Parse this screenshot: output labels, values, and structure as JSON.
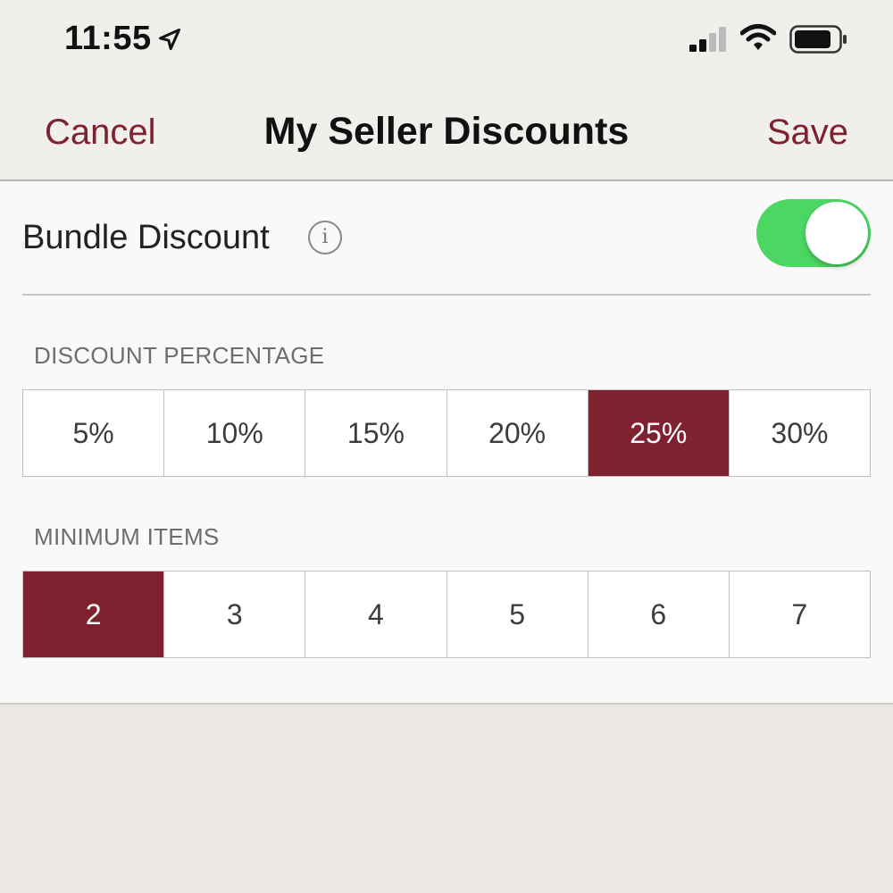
{
  "status": {
    "time": "11:55"
  },
  "nav": {
    "cancel": "Cancel",
    "title": "My Seller Discounts",
    "save": "Save"
  },
  "bundle": {
    "label": "Bundle Discount",
    "info_glyph": "i",
    "enabled": true
  },
  "discount": {
    "heading": "DISCOUNT PERCENTAGE",
    "options": [
      "5%",
      "10%",
      "15%",
      "20%",
      "25%",
      "30%"
    ],
    "selected": "25%"
  },
  "min_items": {
    "heading": "MINIMUM ITEMS",
    "options": [
      "2",
      "3",
      "4",
      "5",
      "6",
      "7"
    ],
    "selected": "2"
  },
  "colors": {
    "accent": "#7e2230",
    "toggle_on": "#4cd762"
  }
}
